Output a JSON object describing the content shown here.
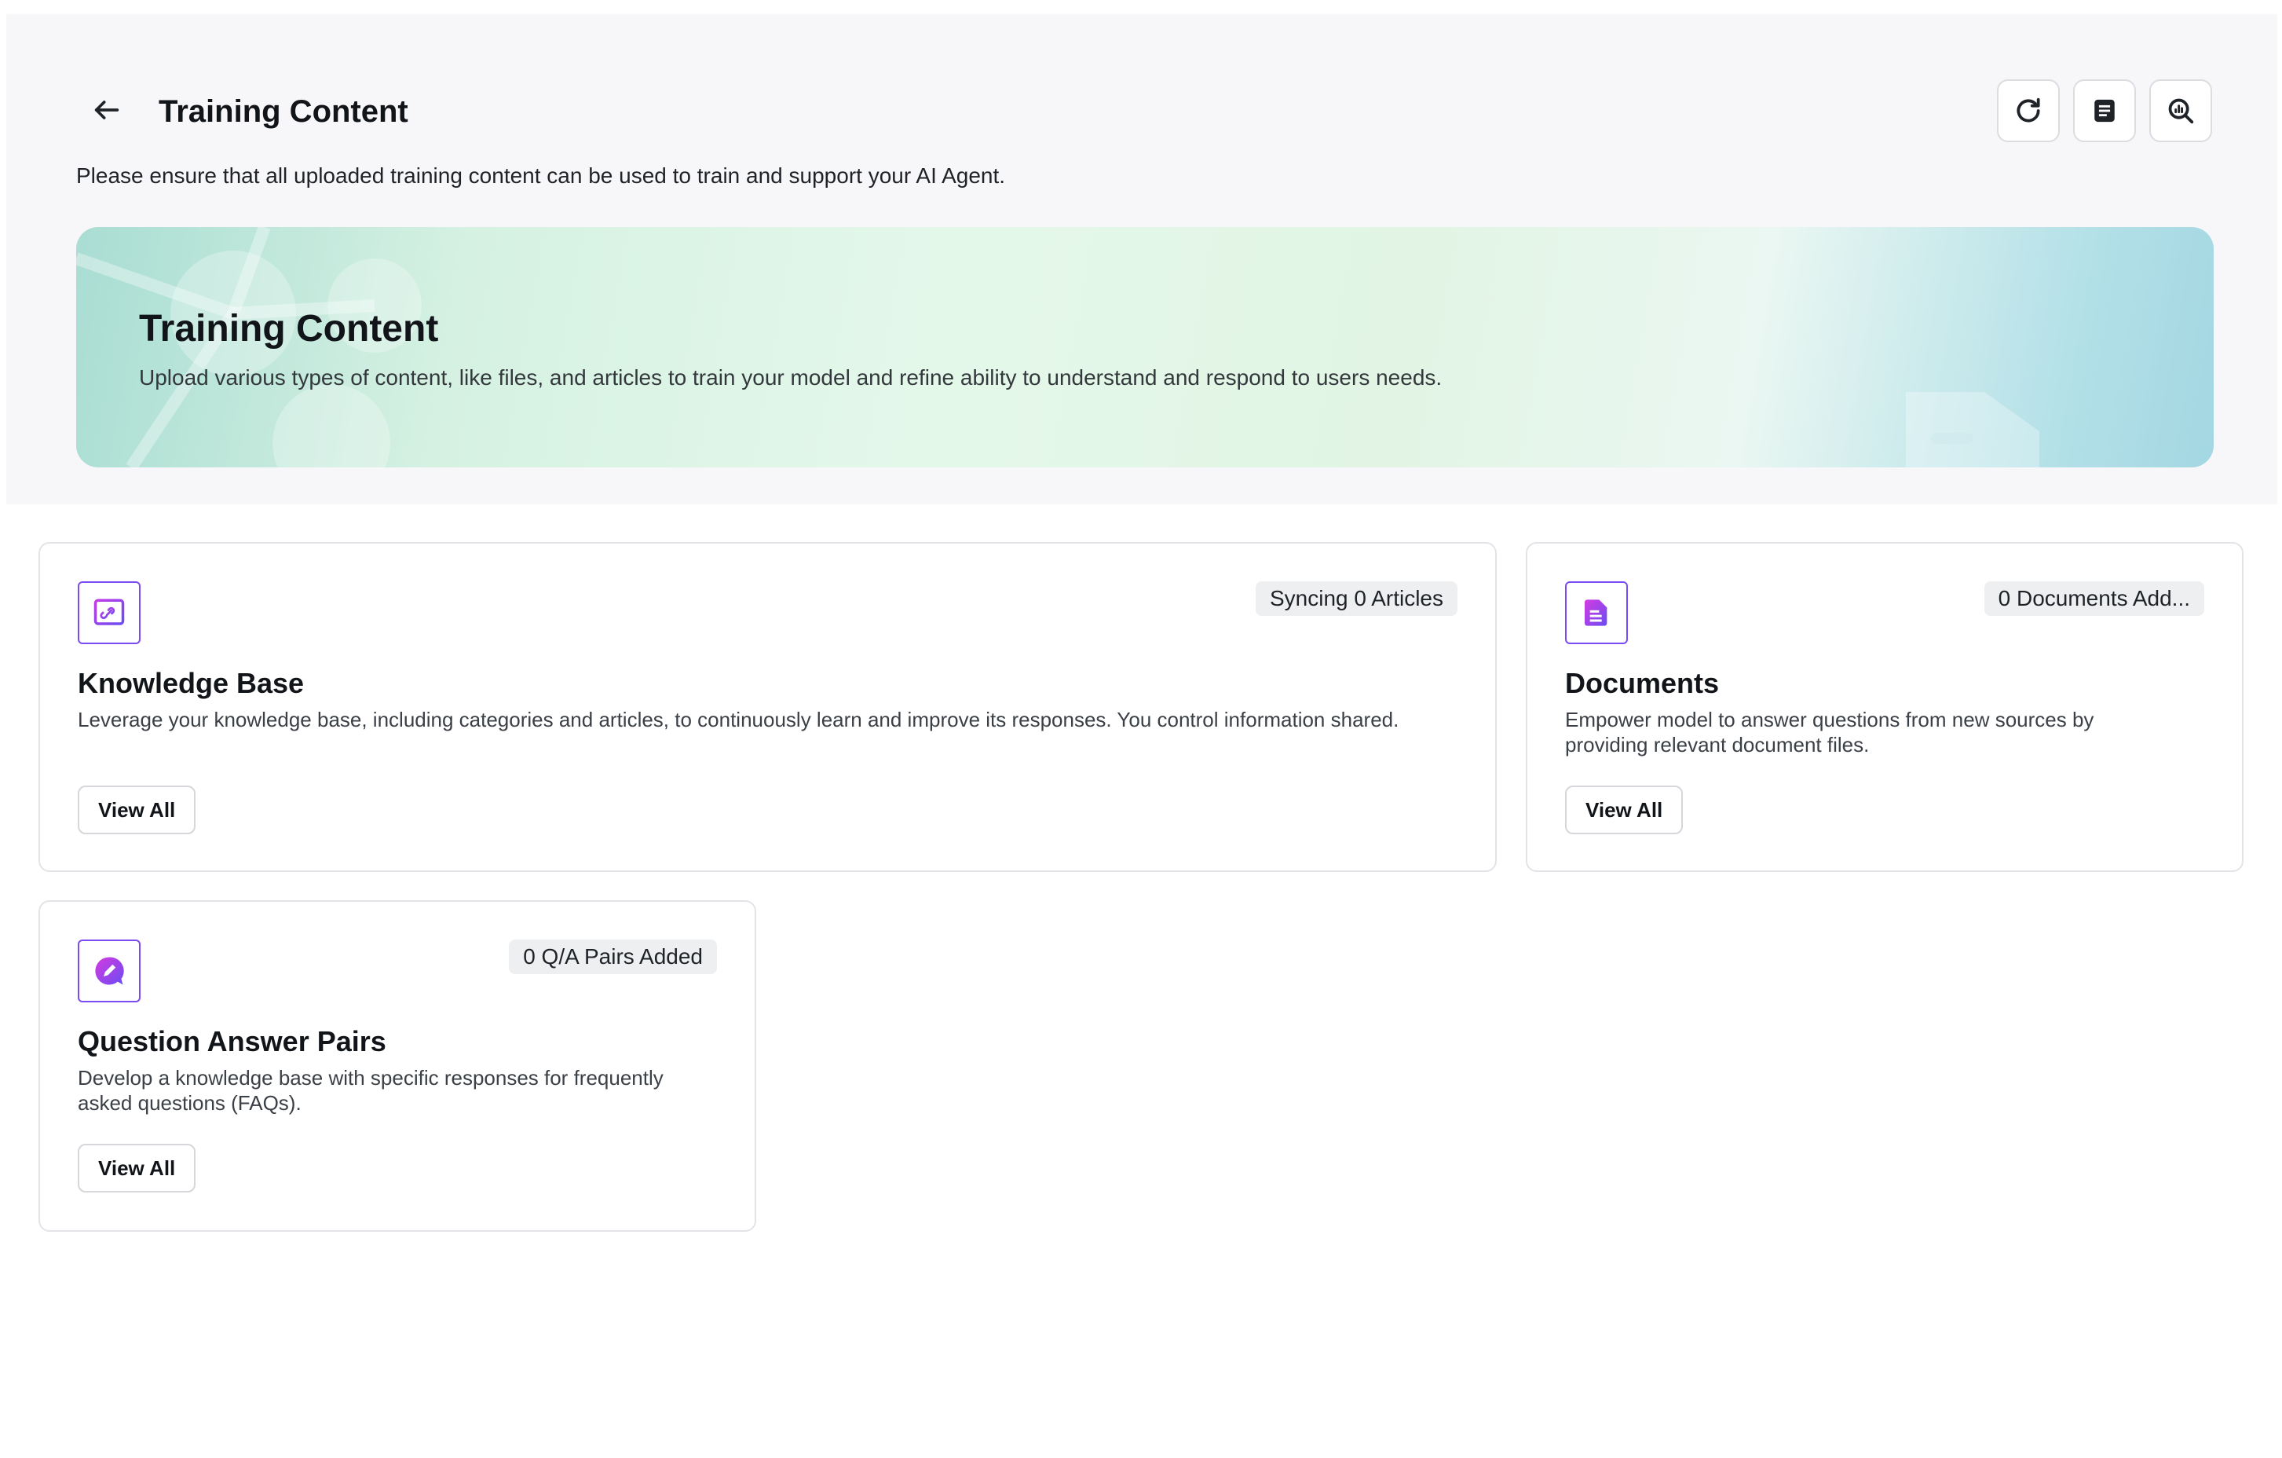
{
  "header": {
    "title": "Training Content",
    "notice": "Please ensure that all uploaded training content can be used to train and support your AI Agent.",
    "actions": [
      {
        "icon": "refresh-icon"
      },
      {
        "icon": "document-icon"
      },
      {
        "icon": "search-analytics-icon"
      }
    ]
  },
  "banner": {
    "title": "Training Content",
    "subtitle": "Upload various types of content, like files, and articles to train your model and refine ability to understand and respond to users needs."
  },
  "cards": {
    "knowledge_base": {
      "icon": "link-window-icon",
      "badge": "Syncing 0 Articles",
      "title": "Knowledge Base",
      "description": "Leverage your knowledge base, including categories and articles, to continuously learn and improve its responses. You control information shared.",
      "button": "View All"
    },
    "documents": {
      "icon": "file-icon",
      "badge": "0 Documents Add...",
      "title": "Documents",
      "description": "Empower model to answer questions from new sources by providing relevant document files.",
      "button": "View All"
    },
    "qa_pairs": {
      "icon": "chat-edit-icon",
      "badge": "0 Q/A Pairs Added",
      "title": "Question Answer Pairs",
      "description": "Develop a knowledge base with specific responses for frequently asked questions (FAQs).",
      "button": "View All"
    }
  },
  "colors": {
    "panel_bg": "#f7f7f9",
    "accent_purple": "#7b4cf3",
    "accent_magenta": "#c13be6",
    "badge_bg": "#eeeff1",
    "border": "#e3e4e8"
  }
}
